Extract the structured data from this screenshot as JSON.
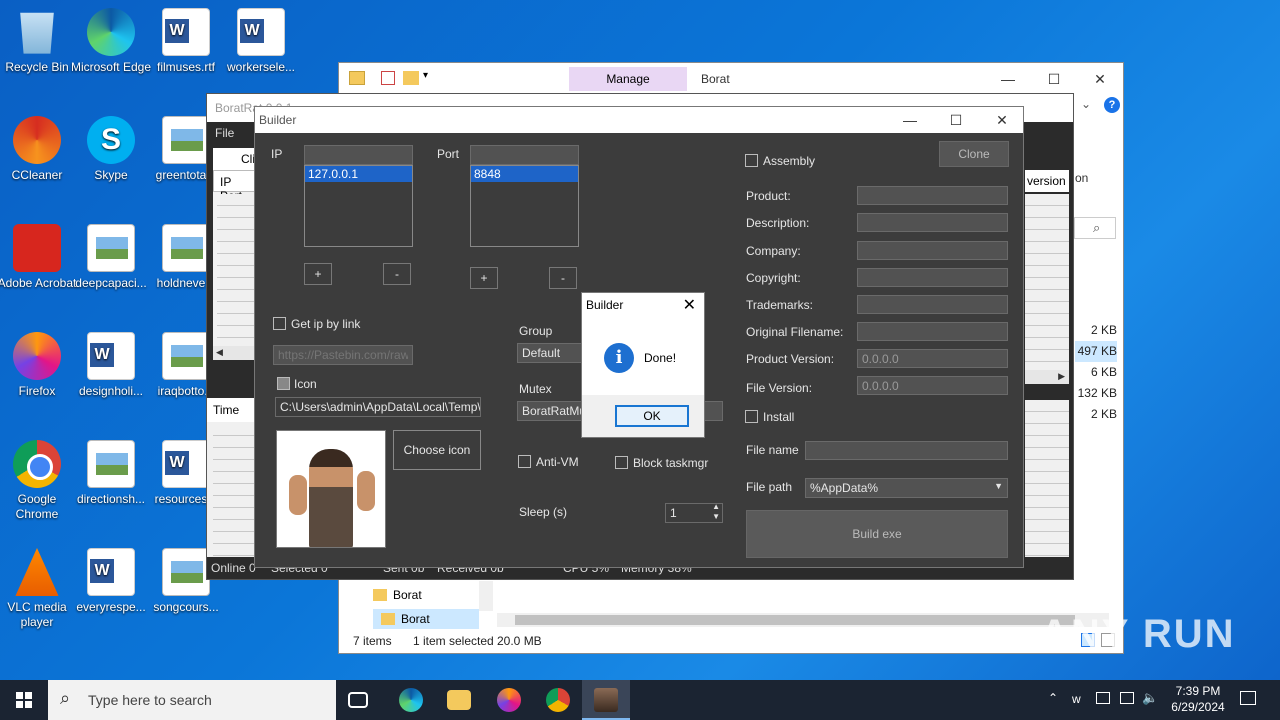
{
  "desktop": {
    "icons": [
      {
        "label": "Recycle Bin"
      },
      {
        "label": "Microsoft Edge"
      },
      {
        "label": "filmuses.rtf"
      },
      {
        "label": "workersele..."
      },
      {
        "label": "CCleaner"
      },
      {
        "label": "Skype"
      },
      {
        "label": "greentota..."
      },
      {
        "label": "Adobe Acrobat"
      },
      {
        "label": "deepcapaci..."
      },
      {
        "label": "holdneve..."
      },
      {
        "label": "Firefox"
      },
      {
        "label": "designholi..."
      },
      {
        "label": "iraqbotto..."
      },
      {
        "label": "Google Chrome"
      },
      {
        "label": "directionsh..."
      },
      {
        "label": "resources..."
      },
      {
        "label": "VLC media player"
      },
      {
        "label": "everyrespe..."
      },
      {
        "label": "songcours..."
      }
    ]
  },
  "explorer": {
    "manage_tab": "Manage",
    "folder_name": "Borat",
    "tree_items": [
      "Borat",
      "Borat"
    ],
    "sizes": [
      "2 KB",
      "497 KB",
      "6 KB",
      "132 KB",
      "2 KB"
    ],
    "status_items": "7 items",
    "status_selected": "1 item selected",
    "status_size": "20.0 MB",
    "col_version": "version",
    "col_on": "on"
  },
  "borat": {
    "title": "BoratRat 0.0.1",
    "menu_file": "File",
    "col_ip_port": "IP Port",
    "col_time": "Time",
    "status_online": "Online 0",
    "status_selected": "Selected 0",
    "status_sent": "Sent 0b",
    "status_received": "Received 0b",
    "status_cpu": "CPU 5%",
    "status_memory": "Memory 38%"
  },
  "builder": {
    "title": "Builder",
    "ip_label": "IP",
    "ip_value": "127.0.0.1",
    "port_label": "Port",
    "port_value": "8848",
    "plus": "+",
    "minus": "-",
    "get_ip_label": "Get ip by link",
    "pastebin_placeholder": "https://Pastebin.com/raw/fe",
    "icon_label": "Icon",
    "icon_path": "C:\\Users\\admin\\AppData\\Local\\Temp\\Im",
    "choose_icon": "Choose icon",
    "group_label": "Group",
    "group_value": "Default",
    "mutex_label": "Mutex",
    "mutex_value": "BoratRatMut",
    "anti_vm": "Anti-VM",
    "block_taskmgr": "Block taskmgr",
    "sleep_label": "Sleep (s)",
    "sleep_value": "1",
    "assembly": "Assembly",
    "clone": "Clone",
    "product": "Product:",
    "description": "Description:",
    "company": "Company:",
    "copyright": "Copyright:",
    "trademarks": "Trademarks:",
    "original_filename": "Original Filename:",
    "product_version": "Product Version:",
    "product_version_value": "0.0.0.0",
    "file_version": "File Version:",
    "file_version_value": "0.0.0.0",
    "install": "Install",
    "file_name": "File name",
    "file_path": "File path",
    "file_path_value": "%AppData%",
    "build": "Build exe"
  },
  "dialog": {
    "title": "Builder",
    "message": "Done!",
    "ok": "OK"
  },
  "taskbar": {
    "search_placeholder": "Type here to search",
    "time": "7:39 PM",
    "date": "6/29/2024"
  },
  "watermark": "ANY RUN"
}
